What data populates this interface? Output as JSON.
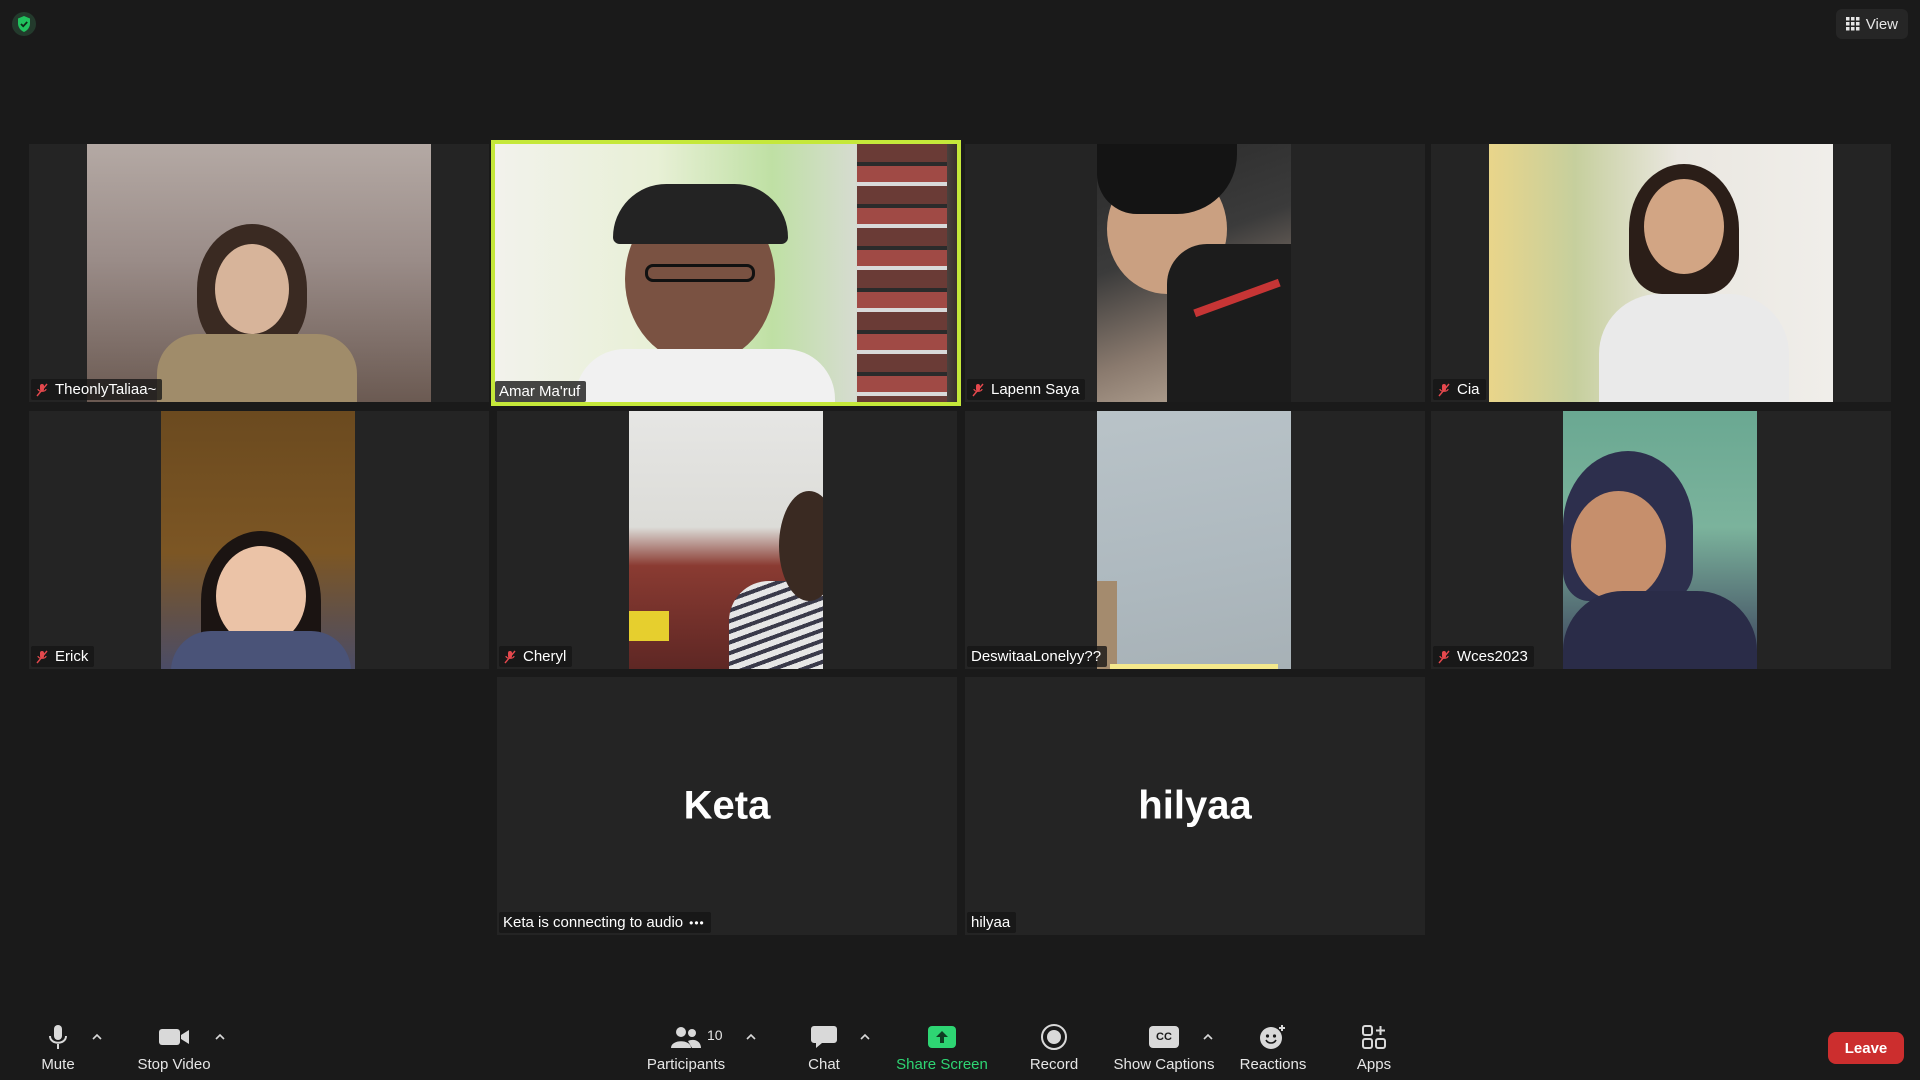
{
  "top_bar": {
    "view_label": "View"
  },
  "participants": [
    {
      "name": "TheonlyTaliaa~",
      "muted": true
    },
    {
      "name": "Amar Ma'ruf",
      "muted": false,
      "active_speaker": true
    },
    {
      "name": "Lapenn Saya",
      "muted": true
    },
    {
      "name": "Cia",
      "muted": true
    },
    {
      "name": "Erick",
      "muted": true
    },
    {
      "name": "Cheryl",
      "muted": true
    },
    {
      "name": "DeswitaaLonelyy??",
      "muted": false
    },
    {
      "name": "Wces2023",
      "muted": true
    },
    {
      "name": "Keta",
      "label": "Keta is connecting to audio",
      "video_off": true
    },
    {
      "name": "hilyaa",
      "label": "hilyaa",
      "video_off": true
    }
  ],
  "toolbar": {
    "mute_label": "Mute",
    "stop_video_label": "Stop Video",
    "participants_label": "Participants",
    "participants_count": "10",
    "chat_label": "Chat",
    "share_screen_label": "Share Screen",
    "record_label": "Record",
    "captions_label": "Show Captions",
    "cc_text": "CC",
    "reactions_label": "Reactions",
    "apps_label": "Apps",
    "leave_label": "Leave"
  },
  "colors": {
    "active_speaker": "#c5e83a",
    "share": "#2ed573",
    "leave": "#cc2e2e",
    "shield": "#21c25e"
  }
}
